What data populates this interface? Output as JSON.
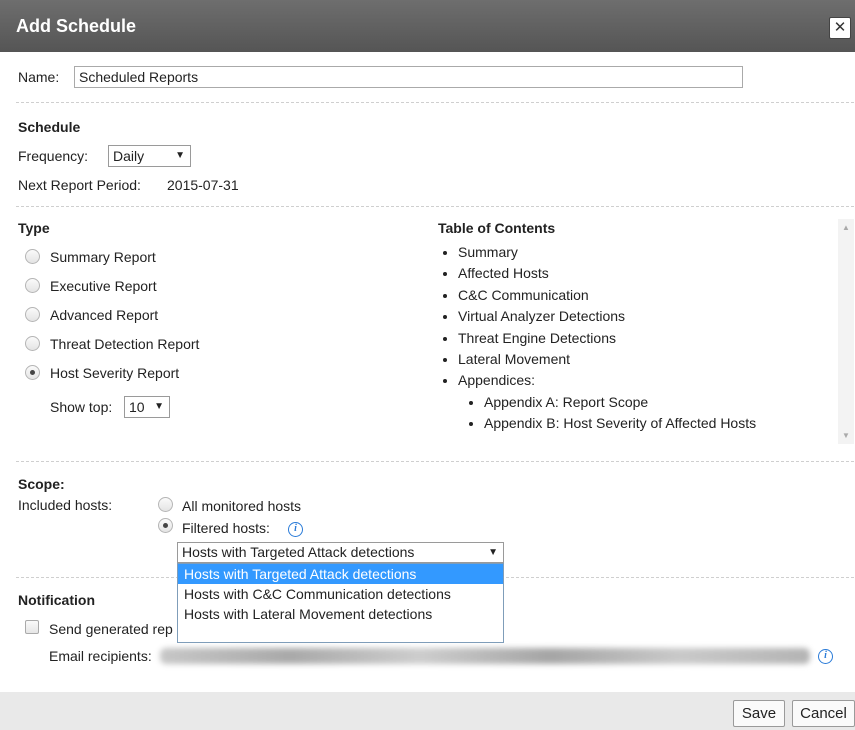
{
  "dialog": {
    "title": "Add Schedule",
    "close_glyph": "✕"
  },
  "name": {
    "label": "Name:",
    "value": "Scheduled Reports"
  },
  "schedule": {
    "heading": "Schedule",
    "frequency_label": "Frequency:",
    "frequency_value": "Daily",
    "next_period_label": "Next Report Period:",
    "next_period_value": "2015-07-31"
  },
  "type": {
    "heading": "Type",
    "options": [
      {
        "label": "Summary Report",
        "checked": false
      },
      {
        "label": "Executive Report",
        "checked": false
      },
      {
        "label": "Advanced Report",
        "checked": false
      },
      {
        "label": "Threat Detection Report",
        "checked": false
      },
      {
        "label": "Host Severity Report",
        "checked": true
      }
    ],
    "show_top_label": "Show top:",
    "show_top_value": "10"
  },
  "toc": {
    "heading": "Table of Contents",
    "items": [
      "Summary",
      "Affected Hosts",
      "C&C Communication",
      "Virtual Analyzer Detections",
      "Threat Engine Detections",
      "Lateral Movement",
      "Appendices:"
    ],
    "subitems": [
      "Appendix A: Report Scope",
      "Appendix B: Host Severity of Affected Hosts"
    ]
  },
  "scope": {
    "heading": "Scope:",
    "included_label": "Included hosts:",
    "all_label": "All monitored hosts",
    "filtered_label": "Filtered hosts:",
    "select_value": "Hosts with Targeted Attack detections",
    "options": [
      "Hosts with Targeted Attack detections",
      "Hosts with C&C Communication detections",
      "Hosts with Lateral Movement detections"
    ]
  },
  "notification": {
    "heading": "Notification",
    "send_label": "Send generated rep",
    "email_label": "Email recipients:"
  },
  "footer": {
    "save_label": "Save",
    "cancel_label": "Cancel"
  },
  "colors": {
    "titlebar": "#5f5f5f",
    "accent": "#3399ff",
    "info": "#2a7bd8"
  }
}
